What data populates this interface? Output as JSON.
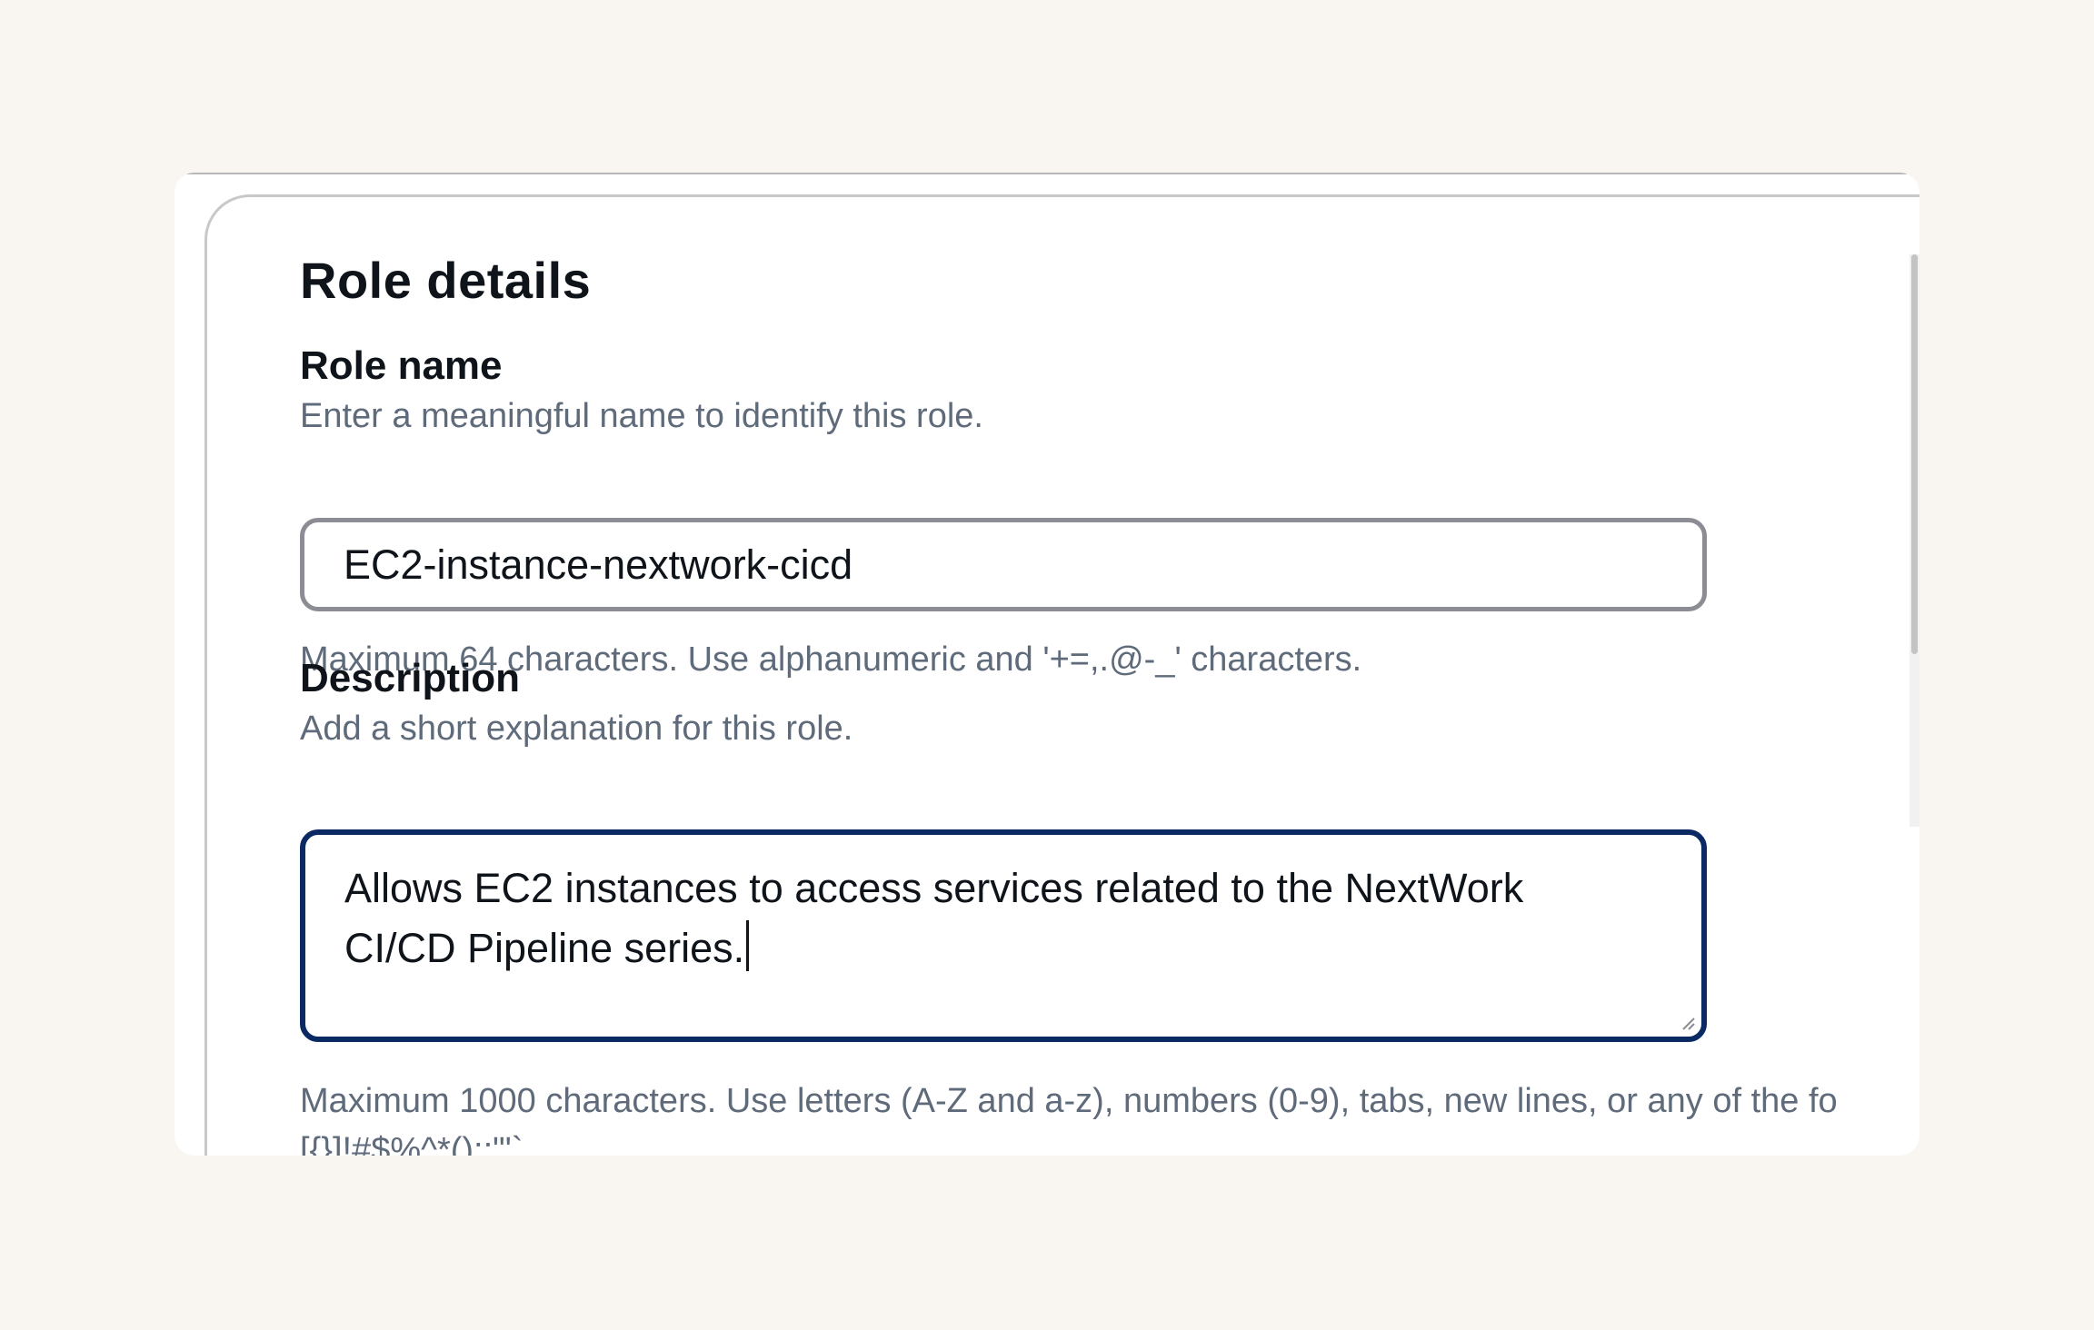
{
  "window": {
    "colors": {
      "page_bg": "#f9f6f1",
      "panel_bg": "#ffffff",
      "text": "#0f141a",
      "muted_text": "#5f6b7a",
      "input_border": "#8c8c94",
      "focus_border": "#0b2a63"
    }
  },
  "section": {
    "title": "Role details"
  },
  "role_name": {
    "label": "Role name",
    "description": "Enter a meaningful name to identify this role.",
    "value": "EC2-instance-nextwork-cicd",
    "constraint": "Maximum 64 characters. Use alphanumeric and '+=,.@-_' characters."
  },
  "description": {
    "label": "Description",
    "description": "Add a short explanation for this role.",
    "value": "Allows EC2 instances to access services related to the NextWork CI/CD Pipeline series.",
    "constraint_line1": "Maximum 1000 characters. Use letters (A-Z and a-z), numbers (0-9), tabs, new lines, or any of the fo",
    "constraint_line2": "[{}]!#$%^*():;\"'`"
  }
}
